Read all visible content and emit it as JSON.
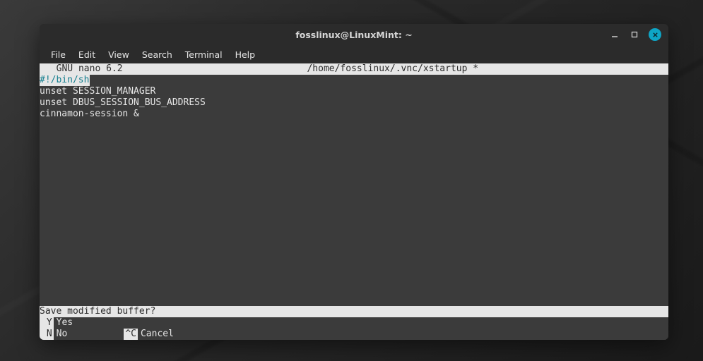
{
  "window": {
    "title": "fosslinux@LinuxMint: ~"
  },
  "menubar": {
    "items": [
      {
        "label": "File"
      },
      {
        "label": "Edit"
      },
      {
        "label": "View"
      },
      {
        "label": "Search"
      },
      {
        "label": "Terminal"
      },
      {
        "label": "Help"
      }
    ]
  },
  "nano": {
    "app": "  GNU nano 6.2",
    "filename": "/home/fosslinux/.vnc/xstartup *",
    "content": {
      "shebang": "#!/bin/sh",
      "line1": "unset SESSION_MANAGER",
      "line2": "unset DBUS_SESSION_BUS_ADDRESS",
      "line3": "cinnamon-session &"
    },
    "prompt": "Save modified buffer? ",
    "shortcuts": {
      "y_key": " Y",
      "y_label": "Yes",
      "n_key": " N",
      "n_label": "No",
      "c_key": "^C",
      "c_label": "Cancel"
    }
  }
}
